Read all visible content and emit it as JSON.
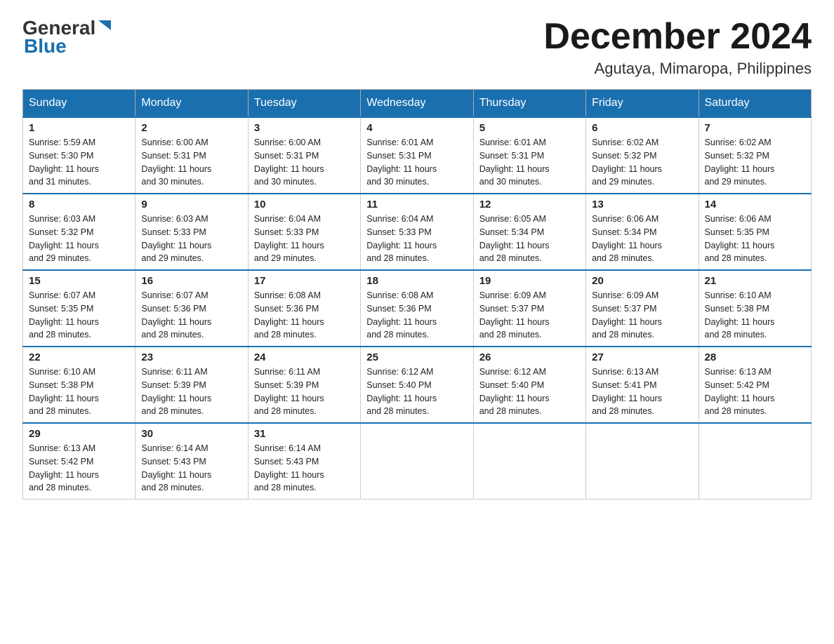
{
  "logo": {
    "general": "General",
    "blue": "Blue"
  },
  "header": {
    "title": "December 2024",
    "subtitle": "Agutaya, Mimaropa, Philippines"
  },
  "weekdays": [
    "Sunday",
    "Monday",
    "Tuesday",
    "Wednesday",
    "Thursday",
    "Friday",
    "Saturday"
  ],
  "weeks": [
    [
      {
        "day": "1",
        "sunrise": "5:59 AM",
        "sunset": "5:30 PM",
        "daylight": "11 hours and 31 minutes."
      },
      {
        "day": "2",
        "sunrise": "6:00 AM",
        "sunset": "5:31 PM",
        "daylight": "11 hours and 30 minutes."
      },
      {
        "day": "3",
        "sunrise": "6:00 AM",
        "sunset": "5:31 PM",
        "daylight": "11 hours and 30 minutes."
      },
      {
        "day": "4",
        "sunrise": "6:01 AM",
        "sunset": "5:31 PM",
        "daylight": "11 hours and 30 minutes."
      },
      {
        "day": "5",
        "sunrise": "6:01 AM",
        "sunset": "5:31 PM",
        "daylight": "11 hours and 30 minutes."
      },
      {
        "day": "6",
        "sunrise": "6:02 AM",
        "sunset": "5:32 PM",
        "daylight": "11 hours and 29 minutes."
      },
      {
        "day": "7",
        "sunrise": "6:02 AM",
        "sunset": "5:32 PM",
        "daylight": "11 hours and 29 minutes."
      }
    ],
    [
      {
        "day": "8",
        "sunrise": "6:03 AM",
        "sunset": "5:32 PM",
        "daylight": "11 hours and 29 minutes."
      },
      {
        "day": "9",
        "sunrise": "6:03 AM",
        "sunset": "5:33 PM",
        "daylight": "11 hours and 29 minutes."
      },
      {
        "day": "10",
        "sunrise": "6:04 AM",
        "sunset": "5:33 PM",
        "daylight": "11 hours and 29 minutes."
      },
      {
        "day": "11",
        "sunrise": "6:04 AM",
        "sunset": "5:33 PM",
        "daylight": "11 hours and 28 minutes."
      },
      {
        "day": "12",
        "sunrise": "6:05 AM",
        "sunset": "5:34 PM",
        "daylight": "11 hours and 28 minutes."
      },
      {
        "day": "13",
        "sunrise": "6:06 AM",
        "sunset": "5:34 PM",
        "daylight": "11 hours and 28 minutes."
      },
      {
        "day": "14",
        "sunrise": "6:06 AM",
        "sunset": "5:35 PM",
        "daylight": "11 hours and 28 minutes."
      }
    ],
    [
      {
        "day": "15",
        "sunrise": "6:07 AM",
        "sunset": "5:35 PM",
        "daylight": "11 hours and 28 minutes."
      },
      {
        "day": "16",
        "sunrise": "6:07 AM",
        "sunset": "5:36 PM",
        "daylight": "11 hours and 28 minutes."
      },
      {
        "day": "17",
        "sunrise": "6:08 AM",
        "sunset": "5:36 PM",
        "daylight": "11 hours and 28 minutes."
      },
      {
        "day": "18",
        "sunrise": "6:08 AM",
        "sunset": "5:36 PM",
        "daylight": "11 hours and 28 minutes."
      },
      {
        "day": "19",
        "sunrise": "6:09 AM",
        "sunset": "5:37 PM",
        "daylight": "11 hours and 28 minutes."
      },
      {
        "day": "20",
        "sunrise": "6:09 AM",
        "sunset": "5:37 PM",
        "daylight": "11 hours and 28 minutes."
      },
      {
        "day": "21",
        "sunrise": "6:10 AM",
        "sunset": "5:38 PM",
        "daylight": "11 hours and 28 minutes."
      }
    ],
    [
      {
        "day": "22",
        "sunrise": "6:10 AM",
        "sunset": "5:38 PM",
        "daylight": "11 hours and 28 minutes."
      },
      {
        "day": "23",
        "sunrise": "6:11 AM",
        "sunset": "5:39 PM",
        "daylight": "11 hours and 28 minutes."
      },
      {
        "day": "24",
        "sunrise": "6:11 AM",
        "sunset": "5:39 PM",
        "daylight": "11 hours and 28 minutes."
      },
      {
        "day": "25",
        "sunrise": "6:12 AM",
        "sunset": "5:40 PM",
        "daylight": "11 hours and 28 minutes."
      },
      {
        "day": "26",
        "sunrise": "6:12 AM",
        "sunset": "5:40 PM",
        "daylight": "11 hours and 28 minutes."
      },
      {
        "day": "27",
        "sunrise": "6:13 AM",
        "sunset": "5:41 PM",
        "daylight": "11 hours and 28 minutes."
      },
      {
        "day": "28",
        "sunrise": "6:13 AM",
        "sunset": "5:42 PM",
        "daylight": "11 hours and 28 minutes."
      }
    ],
    [
      {
        "day": "29",
        "sunrise": "6:13 AM",
        "sunset": "5:42 PM",
        "daylight": "11 hours and 28 minutes."
      },
      {
        "day": "30",
        "sunrise": "6:14 AM",
        "sunset": "5:43 PM",
        "daylight": "11 hours and 28 minutes."
      },
      {
        "day": "31",
        "sunrise": "6:14 AM",
        "sunset": "5:43 PM",
        "daylight": "11 hours and 28 minutes."
      },
      null,
      null,
      null,
      null
    ]
  ],
  "labels": {
    "sunrise": "Sunrise:",
    "sunset": "Sunset:",
    "daylight": "Daylight:"
  }
}
